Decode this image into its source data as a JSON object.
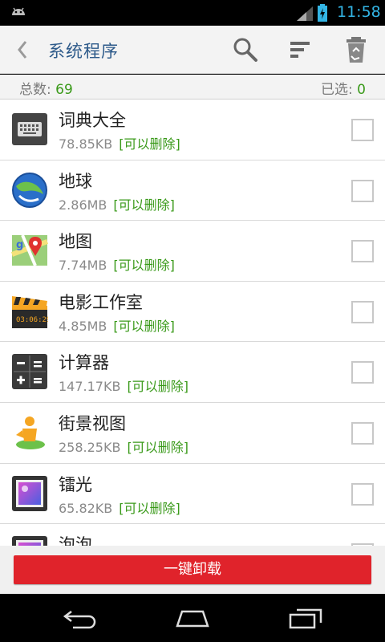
{
  "status_bar": {
    "time": "11:58"
  },
  "app_bar": {
    "title": "系统程序"
  },
  "summary": {
    "total_label": "总数:",
    "total_count": "69",
    "selected_label": "已选:",
    "selected_count": "0"
  },
  "apps": [
    {
      "name": "词典大全",
      "size": "78.85KB",
      "tag": "[可以删除]",
      "icon": "keyboard-icon"
    },
    {
      "name": "地球",
      "size": "2.86MB",
      "tag": "[可以删除]",
      "icon": "google-earth-icon"
    },
    {
      "name": "地图",
      "size": "7.74MB",
      "tag": "[可以删除]",
      "icon": "maps-icon"
    },
    {
      "name": "电影工作室",
      "size": "4.85MB",
      "tag": "[可以删除]",
      "icon": "movie-studio-icon"
    },
    {
      "name": "计算器",
      "size": "147.17KB",
      "tag": "[可以删除]",
      "icon": "calculator-icon"
    },
    {
      "name": "街景视图",
      "size": "258.25KB",
      "tag": "[可以删除]",
      "icon": "street-view-icon"
    },
    {
      "name": "镭光",
      "size": "65.82KB",
      "tag": "[可以删除]",
      "icon": "live-wallpaper-icon"
    },
    {
      "name": "泡泡",
      "size": "",
      "tag": "",
      "icon": "live-wallpaper-icon"
    }
  ],
  "action": {
    "uninstall_label": "一键卸载"
  },
  "colors": {
    "accent_green": "#3a9a1a",
    "title_blue": "#2d5a8a",
    "button_red": "#e0232b",
    "status_blue": "#33b5e5"
  }
}
